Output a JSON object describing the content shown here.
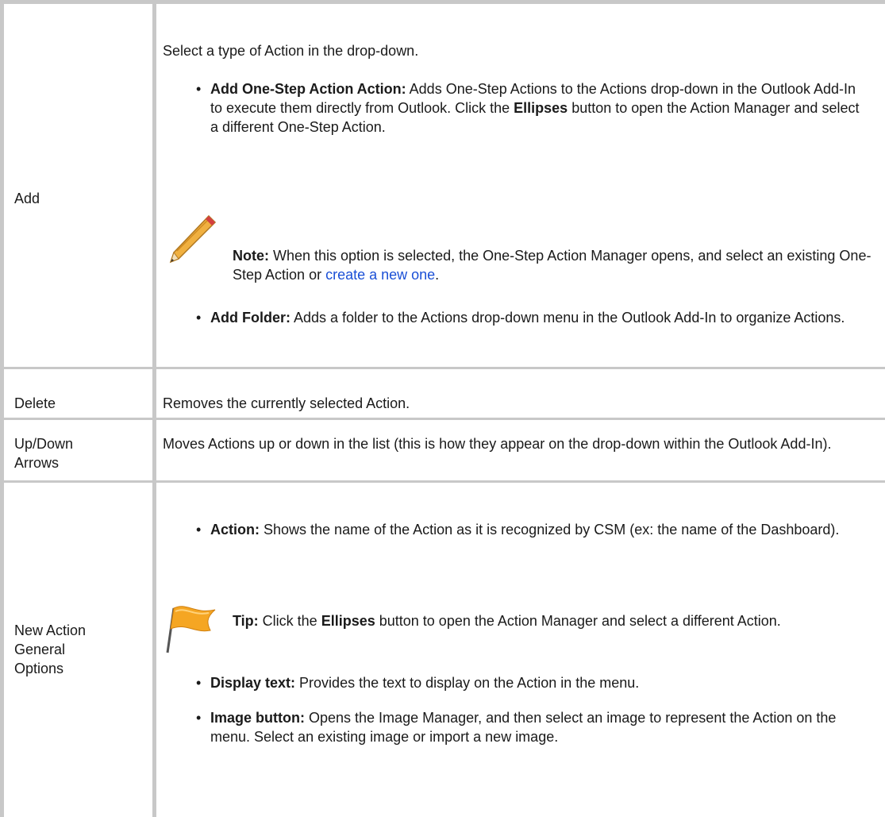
{
  "rows": [
    {
      "label": "Add",
      "intro": "Select a type of Action in the drop-down.",
      "bullet1_bold": "Add One-Step Action Action:",
      "bullet1_text1": " Adds One-Step Actions to the Actions drop-down in the Outlook Add-In to execute them directly from Outlook. Click the ",
      "bullet1_bold2": "Ellipses",
      "bullet1_text2": " button to open the Action Manager and select a different One-Step Action.",
      "note_bold": "Note:",
      "note_text": " When this option is selected, the One-Step Action Manager opens, and select an existing One-Step Action or ",
      "note_link": "create a new one",
      "note_end": ".",
      "bullet2_bold": "Add Folder:",
      "bullet2_text": " Adds a folder to the Actions drop-down menu in the Outlook Add-In to organize Actions."
    },
    {
      "label": "Delete",
      "text": "Removes the currently selected Action."
    },
    {
      "label_line1": "Up/Down",
      "label_line2": "Arrows",
      "text": "Moves Actions up or down in the list (this is how they appear on the drop-down within the Outlook Add-In)."
    },
    {
      "label_line1": "New Action",
      "label_line2": "General",
      "label_line3": "Options",
      "bullet1_bold": "Action:",
      "bullet1_text": " Shows the name of the Action as it is recognized by CSM (ex: the name of the Dashboard).",
      "tip_bold": "Tip:",
      "tip_text1": " Click the ",
      "tip_bold2": "Ellipses",
      "tip_text2": " button to open the Action Manager and select a different Action.",
      "bullet2_bold": "Display text:",
      "bullet2_text": " Provides the text to display on the Action in the menu.",
      "bullet3_bold": "Image button:",
      "bullet3_text": " Opens the Image Manager, and then select an image to represent the Action on the menu. Select an existing image or import a new image."
    }
  ],
  "icons": {
    "note": "pencil-icon",
    "tip": "flag-icon",
    "pencil_color": "#e8a030",
    "flag_color": "#f5a623"
  }
}
